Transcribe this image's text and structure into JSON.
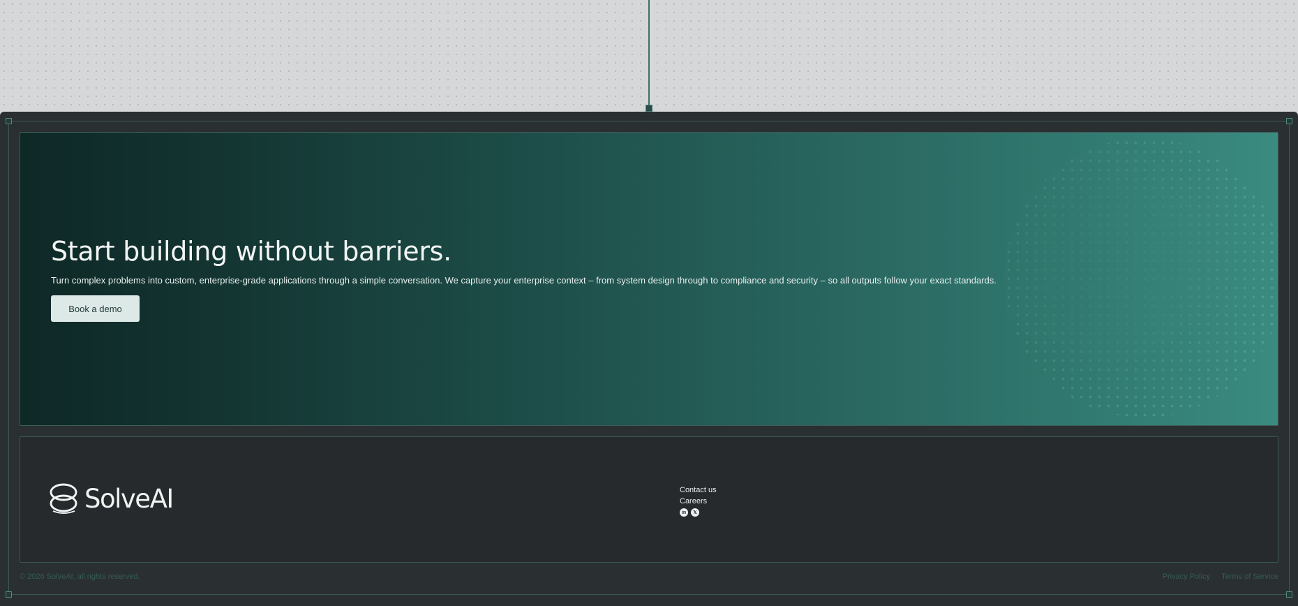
{
  "hero": {
    "title": "Start building without barriers.",
    "description": "Turn complex problems into custom, enterprise-grade applications through a simple conversation. We capture your enterprise context – from system design through to compliance and security – so all outputs follow your exact standards.",
    "cta_label": "Book a demo"
  },
  "footer": {
    "brand": "SolveAI",
    "links": [
      "Contact us",
      "Careers"
    ],
    "socials": [
      {
        "label": "in",
        "icon": "linkedin-icon"
      },
      {
        "label": "𝕏",
        "icon": "x-icon"
      }
    ],
    "copyright": "© 2026 SolveAI, all rights reserved.",
    "legal": [
      "Privacy Policy",
      "Terms of Service"
    ]
  },
  "colors": {
    "accent": "#3b8b80",
    "hero_dark": "#0e2826",
    "footer_bg": "#262a2c",
    "muted_text": "#355c56"
  }
}
